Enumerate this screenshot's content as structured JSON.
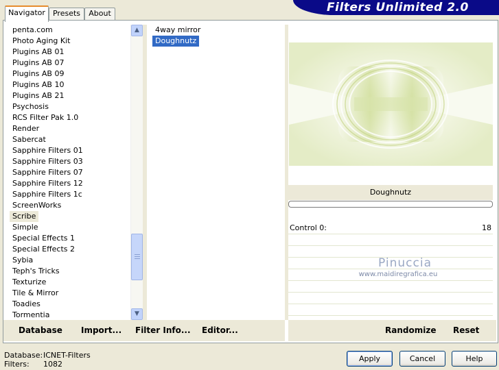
{
  "tabs": [
    {
      "label": "Navigator",
      "active": true
    },
    {
      "label": "Presets",
      "active": false
    },
    {
      "label": "About",
      "active": false
    }
  ],
  "banner": {
    "title": "Filters Unlimited 2.0",
    "color": "#0a0a88"
  },
  "categories": {
    "items": [
      "penta.com",
      "Photo Aging Kit",
      "Plugins AB 01",
      "Plugins AB 07",
      "Plugins AB 09",
      "Plugins AB 10",
      "Plugins AB 21",
      "Psychosis",
      "RCS Filter Pak 1.0",
      "Render",
      "Sabercat",
      "Sapphire Filters 01",
      "Sapphire Filters 03",
      "Sapphire Filters 07",
      "Sapphire Filters 12",
      "Sapphire Filters 1c",
      "ScreenWorks",
      "Scribe",
      "Simple",
      "Special Effects 1",
      "Special Effects 2",
      "Sybia",
      "Teph's Tricks",
      "Texturize",
      "Tile & Mirror",
      "Toadies",
      "Tormentia"
    ],
    "selected": "Scribe"
  },
  "filters": {
    "items": [
      "4way mirror",
      "Doughnutz"
    ],
    "selected": "Doughnutz"
  },
  "preview": {
    "filter_name": "Doughnutz",
    "controls": [
      {
        "label": "Control 0:",
        "value": "18"
      }
    ],
    "watermark": {
      "name": "Pinuccia",
      "url": "www.maidiregrafica.eu"
    }
  },
  "toolbar": {
    "database": "Database",
    "import": "Import...",
    "filter_info": "Filter Info...",
    "editor": "Editor...",
    "randomize": "Randomize",
    "reset": "Reset"
  },
  "status": {
    "database_label": "Database:",
    "database_value": "ICNET-Filters",
    "filters_label": "Filters:",
    "filters_value": "1082"
  },
  "dialog_buttons": {
    "apply": "Apply",
    "cancel": "Cancel",
    "help": "Help"
  },
  "colors": {
    "selection": "#316ac5",
    "dialog_bg": "#ece9d8"
  }
}
